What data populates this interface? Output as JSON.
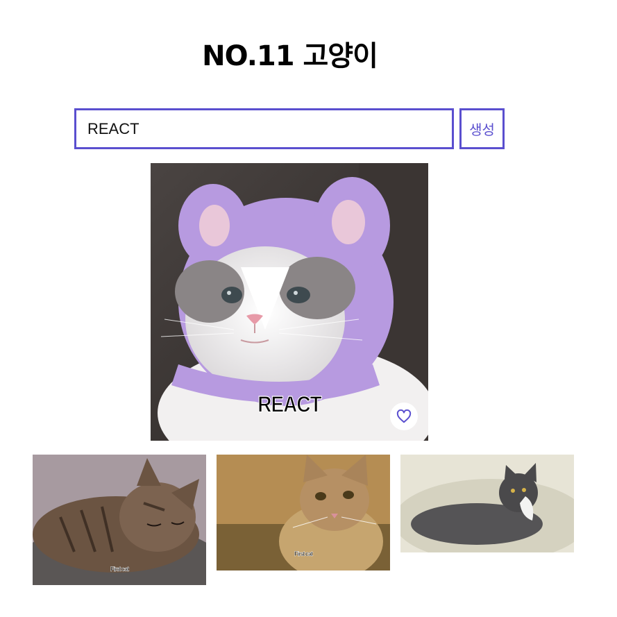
{
  "header": {
    "title": "NO.11 고양이"
  },
  "form": {
    "input_value": "REACT",
    "submit_label": "생성"
  },
  "main_card": {
    "caption": "REACT",
    "like_icon": "heart-outline-icon",
    "accent": "#5a4fcf"
  },
  "history": [
    {
      "caption": "First cat"
    },
    {
      "caption": "First cat"
    },
    {
      "caption": ""
    }
  ]
}
